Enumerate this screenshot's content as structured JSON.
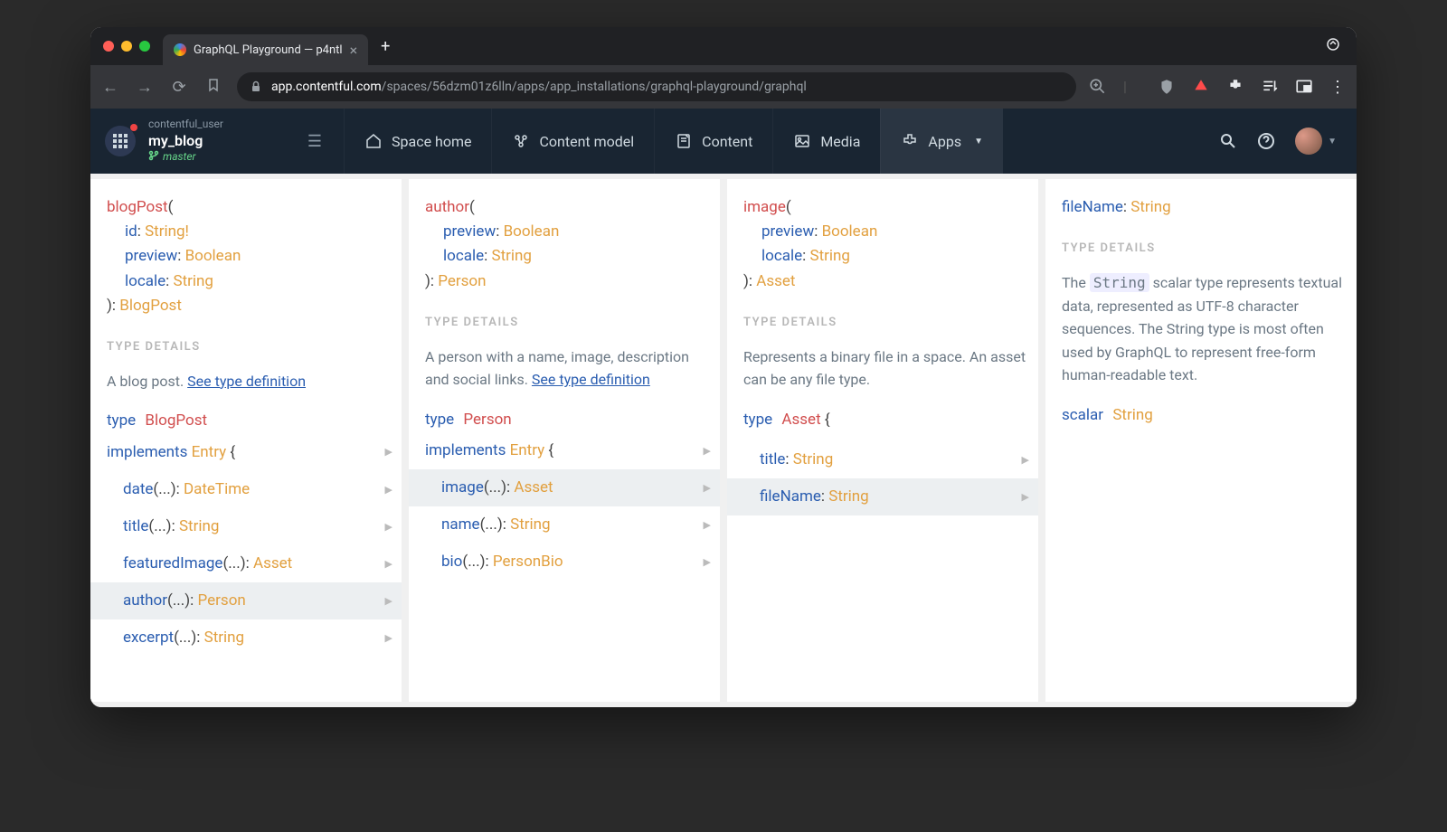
{
  "chrome": {
    "tab_title": "GraphQL Playground — p4ntl",
    "url_host": "app.contentful.com",
    "url_path": "/spaces/56dzm01z6lln/apps/app_installations/graphql-playground/graphql"
  },
  "header": {
    "user": "contentful_user",
    "space": "my_blog",
    "branch": "master",
    "nav": {
      "home": "Space home",
      "model": "Content model",
      "content": "Content",
      "media": "Media",
      "apps": "Apps"
    }
  },
  "labels": {
    "type_details": "TYPE DETAILS",
    "see_def": "See type definition"
  },
  "col1": {
    "fn": "blogPost",
    "args": [
      {
        "name": "id",
        "type": "String!"
      },
      {
        "name": "preview",
        "type": "Boolean"
      },
      {
        "name": "locale",
        "type": "String"
      }
    ],
    "ret": "BlogPost",
    "desc": "A blog post. ",
    "type_kw": "type",
    "type_name": "BlogPost",
    "impl_kw": "implements",
    "impl_name": "Entry",
    "brace": " {",
    "fields": [
      {
        "name": "date",
        "suffix": "(...):",
        "type": "DateTime",
        "sel": false
      },
      {
        "name": "title",
        "suffix": "(...):",
        "type": "String",
        "sel": false
      },
      {
        "name": "featuredImage",
        "suffix": "(...):",
        "type": "Asset",
        "sel": false
      },
      {
        "name": "author",
        "suffix": "(...):",
        "type": "Person",
        "sel": true
      },
      {
        "name": "excerpt",
        "suffix": "(...):",
        "type": "String",
        "sel": false
      }
    ]
  },
  "col2": {
    "fn": "author",
    "args": [
      {
        "name": "preview",
        "type": "Boolean"
      },
      {
        "name": "locale",
        "type": "String"
      }
    ],
    "ret": "Person",
    "desc": "A person with a name, image, description and social links. ",
    "type_kw": "type",
    "type_name": "Person",
    "impl_kw": "implements",
    "impl_name": "Entry",
    "brace": " {",
    "fields": [
      {
        "name": "image",
        "suffix": "(...):",
        "type": "Asset",
        "sel": true
      },
      {
        "name": "name",
        "suffix": "(...):",
        "type": "String",
        "sel": false
      },
      {
        "name": "bio",
        "suffix": "(...):",
        "type": "PersonBio",
        "sel": false
      }
    ]
  },
  "col3": {
    "fn": "image",
    "args": [
      {
        "name": "preview",
        "type": "Boolean"
      },
      {
        "name": "locale",
        "type": "String"
      }
    ],
    "ret": "Asset",
    "desc": "Represents a binary file in a space. An asset can be any file type.",
    "type_kw": "type",
    "type_name": "Asset",
    "brace": " {",
    "fields": [
      {
        "name": "title",
        "suffix": ":",
        "type": "String",
        "sel": false
      },
      {
        "name": "fileName",
        "suffix": ":",
        "type": "String",
        "sel": true
      }
    ]
  },
  "col4": {
    "field": "fileName",
    "field_type": "String",
    "desc_pre": "The ",
    "desc_code": "String",
    "desc_post": " scalar type represents textual data, represented as UTF-8 character sequences. The String type is most often used by GraphQL to represent free-form human-readable text.",
    "scalar_kw": "scalar",
    "scalar_name": "String"
  }
}
